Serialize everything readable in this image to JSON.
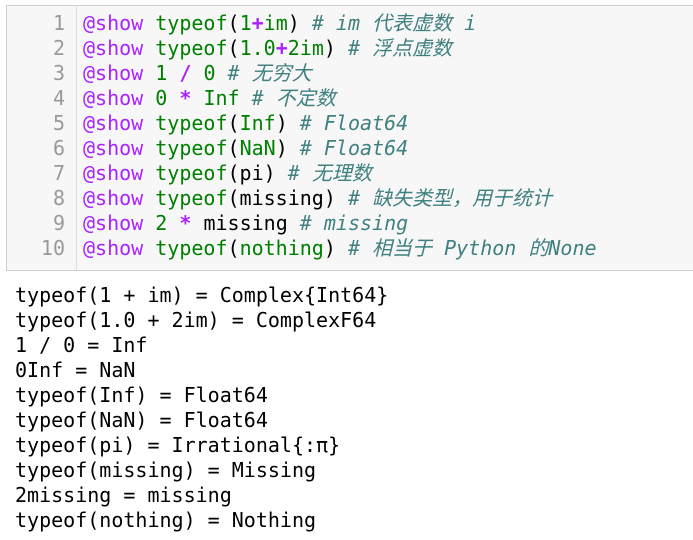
{
  "code_cell": {
    "lines": [
      {
        "n": "1",
        "tokens": [
          {
            "t": "@show",
            "c": "macro"
          },
          {
            "t": " ",
            "c": "ident"
          },
          {
            "t": "typeof",
            "c": "builtin"
          },
          {
            "t": "(",
            "c": "ident"
          },
          {
            "t": "1",
            "c": "number"
          },
          {
            "t": "+",
            "c": "op"
          },
          {
            "t": "im",
            "c": "number"
          },
          {
            "t": ") ",
            "c": "ident"
          },
          {
            "t": "# im 代表虚数 i",
            "c": "comment"
          }
        ]
      },
      {
        "n": "2",
        "tokens": [
          {
            "t": "@show",
            "c": "macro"
          },
          {
            "t": " ",
            "c": "ident"
          },
          {
            "t": "typeof",
            "c": "builtin"
          },
          {
            "t": "(",
            "c": "ident"
          },
          {
            "t": "1.0",
            "c": "number"
          },
          {
            "t": "+",
            "c": "op"
          },
          {
            "t": "2im",
            "c": "number"
          },
          {
            "t": ") ",
            "c": "ident"
          },
          {
            "t": "# 浮点虚数",
            "c": "comment"
          }
        ]
      },
      {
        "n": "3",
        "tokens": [
          {
            "t": "@show",
            "c": "macro"
          },
          {
            "t": " ",
            "c": "ident"
          },
          {
            "t": "1",
            "c": "number"
          },
          {
            "t": " ",
            "c": "ident"
          },
          {
            "t": "/",
            "c": "op"
          },
          {
            "t": " ",
            "c": "ident"
          },
          {
            "t": "0",
            "c": "number"
          },
          {
            "t": " ",
            "c": "ident"
          },
          {
            "t": "# 无穷大",
            "c": "comment"
          }
        ]
      },
      {
        "n": "4",
        "tokens": [
          {
            "t": "@show",
            "c": "macro"
          },
          {
            "t": " ",
            "c": "ident"
          },
          {
            "t": "0",
            "c": "number"
          },
          {
            "t": " ",
            "c": "ident"
          },
          {
            "t": "*",
            "c": "op"
          },
          {
            "t": " ",
            "c": "ident"
          },
          {
            "t": "Inf",
            "c": "builtin"
          },
          {
            "t": " ",
            "c": "ident"
          },
          {
            "t": "# 不定数",
            "c": "comment"
          }
        ]
      },
      {
        "n": "5",
        "tokens": [
          {
            "t": "@show",
            "c": "macro"
          },
          {
            "t": " ",
            "c": "ident"
          },
          {
            "t": "typeof",
            "c": "builtin"
          },
          {
            "t": "(",
            "c": "ident"
          },
          {
            "t": "Inf",
            "c": "builtin"
          },
          {
            "t": ") ",
            "c": "ident"
          },
          {
            "t": "# Float64",
            "c": "comment"
          }
        ]
      },
      {
        "n": "6",
        "tokens": [
          {
            "t": "@show",
            "c": "macro"
          },
          {
            "t": " ",
            "c": "ident"
          },
          {
            "t": "typeof",
            "c": "builtin"
          },
          {
            "t": "(",
            "c": "ident"
          },
          {
            "t": "NaN",
            "c": "builtin"
          },
          {
            "t": ") ",
            "c": "ident"
          },
          {
            "t": "# Float64",
            "c": "comment"
          }
        ]
      },
      {
        "n": "7",
        "tokens": [
          {
            "t": "@show",
            "c": "macro"
          },
          {
            "t": " ",
            "c": "ident"
          },
          {
            "t": "typeof",
            "c": "builtin"
          },
          {
            "t": "(pi) ",
            "c": "ident"
          },
          {
            "t": "# 无理数",
            "c": "comment"
          }
        ]
      },
      {
        "n": "8",
        "tokens": [
          {
            "t": "@show",
            "c": "macro"
          },
          {
            "t": " ",
            "c": "ident"
          },
          {
            "t": "typeof",
            "c": "builtin"
          },
          {
            "t": "(missing) ",
            "c": "ident"
          },
          {
            "t": "# 缺失类型，用于统计",
            "c": "comment"
          }
        ]
      },
      {
        "n": "9",
        "tokens": [
          {
            "t": "@show",
            "c": "macro"
          },
          {
            "t": " ",
            "c": "ident"
          },
          {
            "t": "2",
            "c": "number"
          },
          {
            "t": " ",
            "c": "ident"
          },
          {
            "t": "*",
            "c": "op"
          },
          {
            "t": " missing ",
            "c": "ident"
          },
          {
            "t": "# missing",
            "c": "comment"
          }
        ]
      },
      {
        "n": "10",
        "tokens": [
          {
            "t": "@show",
            "c": "macro"
          },
          {
            "t": " ",
            "c": "ident"
          },
          {
            "t": "typeof",
            "c": "builtin"
          },
          {
            "t": "(",
            "c": "ident"
          },
          {
            "t": "nothing",
            "c": "builtin"
          },
          {
            "t": ") ",
            "c": "ident"
          },
          {
            "t": "# 相当于 Python 的None",
            "c": "comment"
          }
        ]
      }
    ]
  },
  "output": {
    "lines": [
      "typeof(1 + im) = Complex{Int64}",
      "typeof(1.0 + 2im) = ComplexF64",
      "1 / 0 = Inf",
      "0Inf = NaN",
      "typeof(Inf) = Float64",
      "typeof(NaN) = Float64",
      "typeof(pi) = Irrational{:π}",
      "typeof(missing) = Missing",
      "2missing = missing",
      "typeof(nothing) = Nothing"
    ]
  },
  "colors": {
    "macro": "#aa22ff",
    "builtin": "#008000",
    "number": "#008000",
    "operator": "#aa22ff",
    "comment": "#408080",
    "line_number": "#999999",
    "cell_background": "#f7f7f7"
  }
}
